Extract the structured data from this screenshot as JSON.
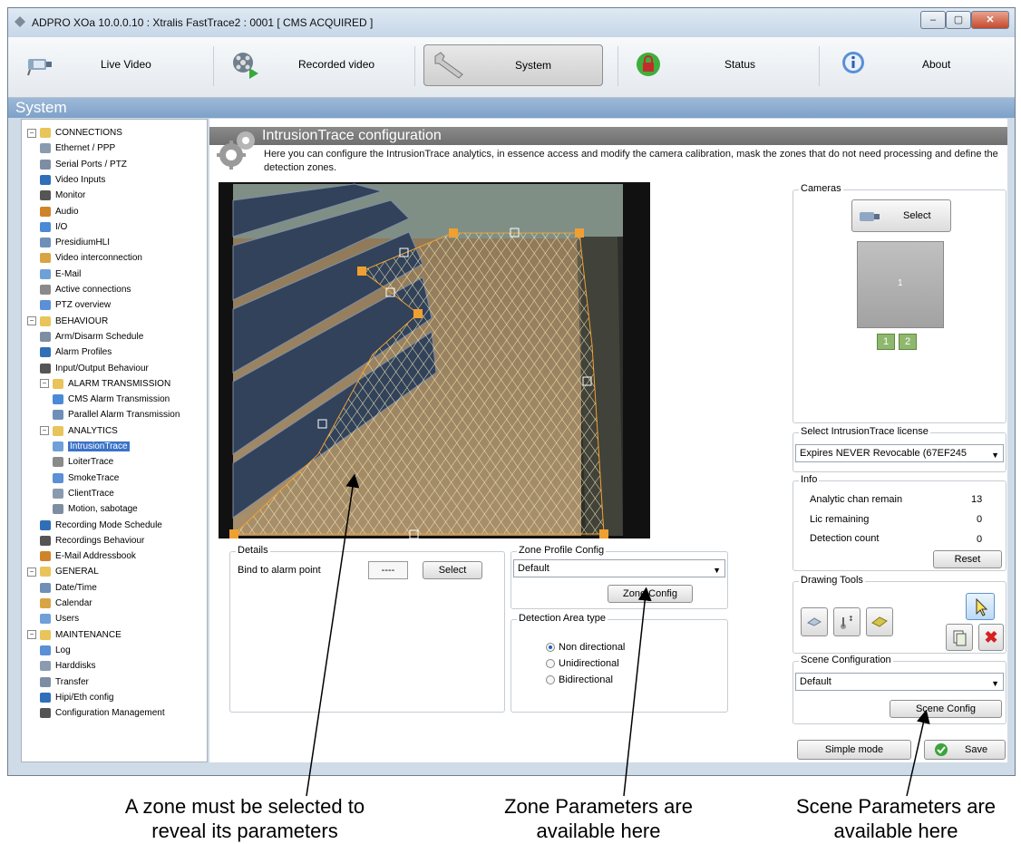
{
  "window": {
    "title": "ADPRO XOa  10.0.0.10 : Xtralis FastTrace2 : 0001  [ CMS ACQUIRED ]",
    "controls": [
      "–",
      "▢",
      "✕"
    ]
  },
  "toolbar": {
    "items": [
      {
        "label": "Live Video",
        "icon": "camera-icon"
      },
      {
        "label": "Recorded video",
        "icon": "film-reel-icon"
      },
      {
        "label": "System",
        "icon": "wrench-icon"
      },
      {
        "label": "Status",
        "icon": "lock-status-icon"
      },
      {
        "label": "About",
        "icon": "info-icon"
      }
    ],
    "active": "System"
  },
  "section_title": "System",
  "tree": {
    "nodes": [
      {
        "label": "CONNECTIONS",
        "level": 0,
        "folder": true
      },
      {
        "label": "Ethernet / PPP",
        "level": 1
      },
      {
        "label": "Serial Ports / PTZ",
        "level": 1
      },
      {
        "label": "Video Inputs",
        "level": 1
      },
      {
        "label": "Monitor",
        "level": 1
      },
      {
        "label": "Audio",
        "level": 1
      },
      {
        "label": "I/O",
        "level": 1
      },
      {
        "label": "PresidiumHLI",
        "level": 1
      },
      {
        "label": "Video interconnection",
        "level": 1
      },
      {
        "label": "E-Mail",
        "level": 1
      },
      {
        "label": "Active connections",
        "level": 1
      },
      {
        "label": "PTZ overview",
        "level": 1
      },
      {
        "label": "BEHAVIOUR",
        "level": 0,
        "folder": true
      },
      {
        "label": "Arm/Disarm Schedule",
        "level": 1
      },
      {
        "label": "Alarm Profiles",
        "level": 1
      },
      {
        "label": "Input/Output Behaviour",
        "level": 1
      },
      {
        "label": "ALARM TRANSMISSION",
        "level": 1,
        "folder": true
      },
      {
        "label": "CMS Alarm Transmission",
        "level": 2
      },
      {
        "label": "Parallel Alarm Transmission",
        "level": 2
      },
      {
        "label": "ANALYTICS",
        "level": 1,
        "folder": true
      },
      {
        "label": "IntrusionTrace",
        "level": 2,
        "selected": true
      },
      {
        "label": "LoiterTrace",
        "level": 2
      },
      {
        "label": "SmokeTrace",
        "level": 2
      },
      {
        "label": "ClientTrace",
        "level": 2
      },
      {
        "label": "Motion, sabotage",
        "level": 2
      },
      {
        "label": "Recording Mode Schedule",
        "level": 1
      },
      {
        "label": "Recordings Behaviour",
        "level": 1
      },
      {
        "label": "E-Mail Addressbook",
        "level": 1
      },
      {
        "label": "GENERAL",
        "level": 0,
        "folder": true
      },
      {
        "label": "Date/Time",
        "level": 1
      },
      {
        "label": "Calendar",
        "level": 1
      },
      {
        "label": "Users",
        "level": 1
      },
      {
        "label": "MAINTENANCE",
        "level": 0,
        "folder": true
      },
      {
        "label": "Log",
        "level": 1
      },
      {
        "label": "Harddisks",
        "level": 1
      },
      {
        "label": "Transfer",
        "level": 1
      },
      {
        "label": "Hipi/Eth config",
        "level": 1
      },
      {
        "label": "Configuration Management",
        "level": 1
      }
    ]
  },
  "config": {
    "title": "IntrusionTrace configuration",
    "description": "Here you can configure the IntrusionTrace analytics, in essence access and modify the camera calibration, mask the zones that do not need processing and define the detection zones."
  },
  "details": {
    "title": "Details",
    "bind_label": "Bind to alarm point",
    "bind_value": "----",
    "select_button": "Select"
  },
  "zone_profile": {
    "title": "Zone Profile Config",
    "selected": "Default",
    "button": "Zone Config"
  },
  "detection_area": {
    "title": "Detection Area type",
    "options": [
      "Non directional",
      "Unidirectional",
      "Bidirectional"
    ],
    "selected": "Non directional"
  },
  "cameras": {
    "title": "Cameras",
    "select_button": "Select",
    "preview_number": "1",
    "channels": [
      "1",
      "2"
    ]
  },
  "license": {
    "title": "Select IntrusionTrace license",
    "selected": "Expires NEVER Revocable  (67EF245"
  },
  "info": {
    "title": "Info",
    "rows": [
      {
        "label": "Analytic chan remain",
        "value": "13"
      },
      {
        "label": "Lic remaining",
        "value": "0"
      },
      {
        "label": "Detection count",
        "value": "0"
      }
    ],
    "reset_button": "Reset"
  },
  "drawing_tools": {
    "title": "Drawing Tools",
    "tools": [
      "polygon-tool-icon",
      "measure-tool-icon",
      "mask-tool-icon",
      "pointer-icon",
      "copy-icon",
      "delete-icon"
    ]
  },
  "scene": {
    "title": "Scene Configuration",
    "selected": "Default",
    "button": "Scene Config"
  },
  "footer": {
    "simple_mode": "Simple mode",
    "save": "Save"
  },
  "annotations": {
    "left": "A zone must be selected to\nreveal its parameters",
    "middle": "Zone Parameters are\navailable here",
    "right": "Scene Parameters are\navailable here"
  }
}
